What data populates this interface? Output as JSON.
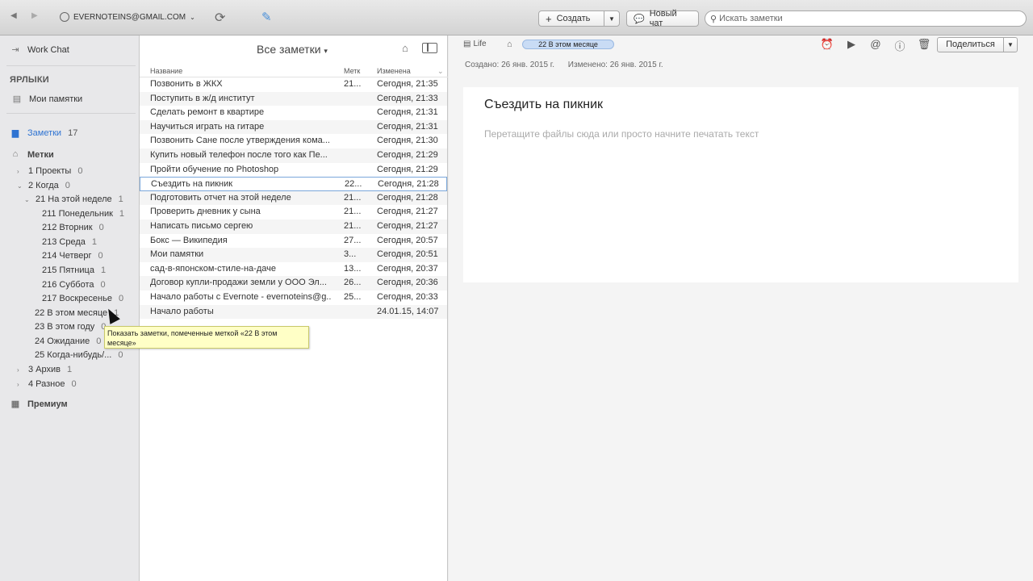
{
  "toolbar": {
    "back_icon": "◀",
    "forward_icon": "▶",
    "account": "EVERNOTEINS@GMAIL.COM",
    "create_label": "Создать",
    "new_chat_label": "Новый чат",
    "search_placeholder": "Искать заметки"
  },
  "sidebar": {
    "work_chat": "Work Chat",
    "shortcuts_heading": "ЯРЛЫКИ",
    "my_reminders": "Мои памятки",
    "notes_label": "Заметки",
    "notes_count": "17",
    "tags_label": "Метки",
    "tags": [
      {
        "label": "1 Проекты",
        "count": "0"
      },
      {
        "label": "2 Когда",
        "count": "0"
      },
      {
        "label": "21 На этой неделе",
        "count": "1"
      },
      {
        "label": "211 Понедельник",
        "count": "1"
      },
      {
        "label": "212 Вторник",
        "count": "0"
      },
      {
        "label": "213 Среда",
        "count": "1"
      },
      {
        "label": "214 Четверг",
        "count": "0"
      },
      {
        "label": "215 Пятница",
        "count": "1"
      },
      {
        "label": "216 Суббота",
        "count": "0"
      },
      {
        "label": "217 Воскресенье",
        "count": "0"
      },
      {
        "label": "22 В этом месяце",
        "count": "1"
      },
      {
        "label": "23 В этом году",
        "count": "0"
      },
      {
        "label": "24 Ожидание",
        "count": "0"
      },
      {
        "label": "25 Когда-нибудь/...",
        "count": "0"
      },
      {
        "label": "3 Архив",
        "count": "1"
      },
      {
        "label": "4 Разное",
        "count": "0"
      }
    ],
    "premium": "Премиум"
  },
  "tooltip": "Показать заметки, помеченные меткой «22 В этом месяце»",
  "notelist": {
    "title": "Все заметки",
    "columns": [
      "Название",
      "Метк",
      "Изменена"
    ],
    "rows": [
      {
        "title": "Позвонить в ЖКХ",
        "tag": "21...",
        "date": "Сегодня, 21:35"
      },
      {
        "title": "Поступить в ж/д институт",
        "tag": "",
        "date": "Сегодня, 21:33"
      },
      {
        "title": "Сделать ремонт в квартире",
        "tag": "",
        "date": "Сегодня, 21:31"
      },
      {
        "title": "Научиться играть на гитаре",
        "tag": "",
        "date": "Сегодня, 21:31"
      },
      {
        "title": "Позвонить Сане после утверждения кома...",
        "tag": "",
        "date": "Сегодня, 21:30"
      },
      {
        "title": "Купить новый телефон после того как Пе...",
        "tag": "",
        "date": "Сегодня, 21:29"
      },
      {
        "title": "Пройти обучение по Photoshop",
        "tag": "",
        "date": "Сегодня, 21:29"
      },
      {
        "title": "Съездить на пикник",
        "tag": "22...",
        "date": "Сегодня, 21:28"
      },
      {
        "title": "Подготовить отчет на этой неделе",
        "tag": "21...",
        "date": "Сегодня, 21:28"
      },
      {
        "title": "Проверить дневник у сына",
        "tag": "21...",
        "date": "Сегодня, 21:27"
      },
      {
        "title": "Написать письмо сергею",
        "tag": "21...",
        "date": "Сегодня, 21:27"
      },
      {
        "title": "Бокс — Википедия",
        "tag": "27...",
        "date": "Сегодня, 20:57"
      },
      {
        "title": "Мои памятки",
        "tag": "3...",
        "date": "Сегодня, 20:51"
      },
      {
        "title": "сад-в-японском-стиле-на-даче",
        "tag": "13...",
        "date": "Сегодня, 20:37"
      },
      {
        "title": "Договор купли-продажи земли у ООО Эл...",
        "tag": "26...",
        "date": "Сегодня, 20:36"
      },
      {
        "title": "Начало работы с Evernote - evernoteins@g...",
        "tag": "25...",
        "date": "Сегодня, 20:33"
      },
      {
        "title": "Начало работы",
        "tag": "",
        "date": "24.01.15, 14:07"
      }
    ]
  },
  "note": {
    "notebook": "Life",
    "tag": "22 В этом месяце",
    "share_label": "Поделиться",
    "created": "Создано: 26 янв. 2015 г.",
    "modified": "Изменено: 26 янв. 2015 г.",
    "title": "Съездить на пикник",
    "placeholder": "Перетащите файлы сюда или просто начните печатать текст"
  }
}
